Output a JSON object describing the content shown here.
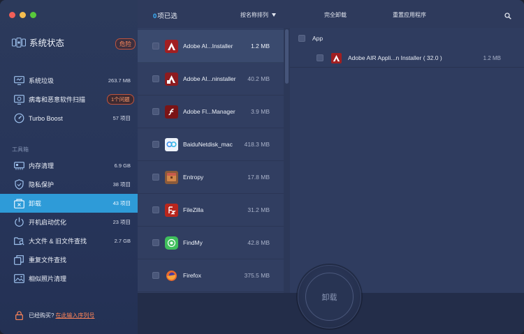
{
  "sidebar": {
    "title": "系统状态",
    "title_badge": "危险",
    "items": [
      {
        "label": "系统垃圾",
        "value": "263.7 MB"
      },
      {
        "label": "病毒和恶意软件扫描",
        "badge": "1个问题"
      },
      {
        "label": "Turbo Boost",
        "value": "57 项目"
      }
    ],
    "section_label": "工具箱",
    "tools": [
      {
        "label": "内存清理",
        "value": "6.9 GB"
      },
      {
        "label": "隐私保护",
        "value": "38 项目"
      },
      {
        "label": "卸载",
        "value": "43 项目",
        "active": true
      },
      {
        "label": "开机启动优化",
        "value": "23 项目"
      },
      {
        "label": "大文件 & 旧文件查找",
        "value": "2.7 GB"
      },
      {
        "label": "重复文件查找",
        "value": ""
      },
      {
        "label": "相似照片清理",
        "value": ""
      }
    ],
    "register_text": "已经购买?",
    "register_link": "在此输入序列号"
  },
  "list": {
    "selected_count": "0",
    "selected_label": "项已选",
    "sort_label": "按名称排列",
    "apps": [
      {
        "name": "Adobe AI...Installer",
        "size": "1.2 MB"
      },
      {
        "name": "Adobe AI...ninstaller",
        "size": "40.2 MB"
      },
      {
        "name": "Adobe Fl...Manager",
        "size": "3.9 MB"
      },
      {
        "name": "BaiduNetdisk_mac",
        "size": "418.3 MB"
      },
      {
        "name": "Entropy",
        "size": "17.8 MB"
      },
      {
        "name": "FileZilla",
        "size": "31.2 MB"
      },
      {
        "name": "FindMy",
        "size": "42.8 MB"
      },
      {
        "name": "Firefox",
        "size": "375.5 MB"
      }
    ]
  },
  "detail": {
    "complete_uninstall": "完全卸载",
    "reset_app": "重置应用程序",
    "group_label": "App",
    "item_name": "Adobe AIR Appli...n Installer ( 32.0 )",
    "item_size": "1.2 MB",
    "uninstall_button": "卸载"
  },
  "colors": {
    "accent": "#2e9bd8",
    "warning": "#ff8a5c",
    "count": "#3db5ff"
  }
}
